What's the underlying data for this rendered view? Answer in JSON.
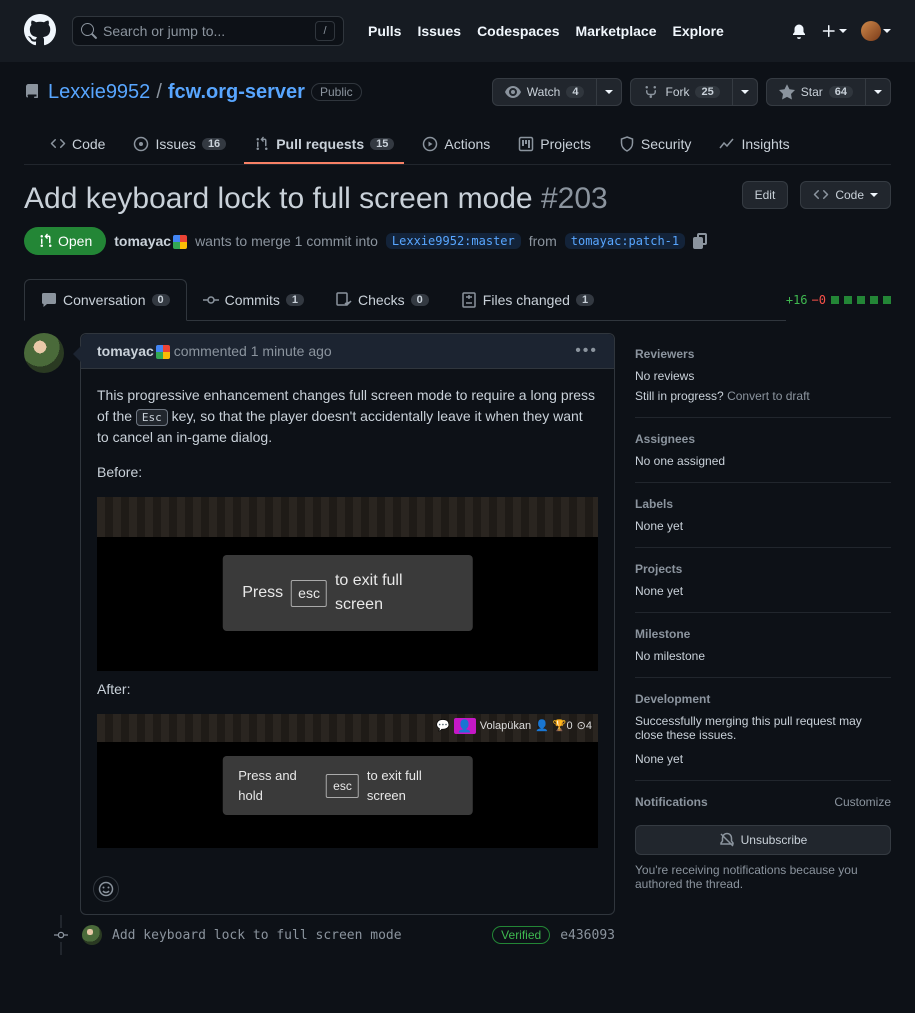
{
  "top": {
    "search_placeholder": "Search or jump to...",
    "nav": {
      "pulls": "Pulls",
      "issues": "Issues",
      "codespaces": "Codespaces",
      "marketplace": "Marketplace",
      "explore": "Explore"
    }
  },
  "repo": {
    "owner": "Lexxie9952",
    "name": "fcw.org-server",
    "visibility": "Public",
    "watch": {
      "label": "Watch",
      "count": "4"
    },
    "fork": {
      "label": "Fork",
      "count": "25"
    },
    "star": {
      "label": "Star",
      "count": "64"
    },
    "tabs": {
      "code": "Code",
      "issues": "Issues",
      "issues_count": "16",
      "pulls": "Pull requests",
      "pulls_count": "15",
      "actions": "Actions",
      "projects": "Projects",
      "security": "Security",
      "insights": "Insights"
    }
  },
  "pr": {
    "title": "Add keyboard lock to full screen mode",
    "number": "#203",
    "edit": "Edit",
    "code_btn": "Code",
    "state": "Open",
    "author": "tomayac",
    "merge_text_1": "wants to merge 1 commit into",
    "base_branch": "Lexxie9952:master",
    "merge_text_2": "from",
    "head_branch": "tomayac:patch-1",
    "subtabs": {
      "conversation": "Conversation",
      "conversation_count": "0",
      "commits": "Commits",
      "commits_count": "1",
      "checks": "Checks",
      "checks_count": "0",
      "files": "Files changed",
      "files_count": "1"
    },
    "diff": {
      "add": "+16",
      "del": "−0"
    }
  },
  "comment": {
    "author": "tomayac",
    "time": "commented 1 minute ago",
    "para1a": "This progressive enhancement changes full screen mode to require a long press of the ",
    "para1_key": "Esc",
    "para1b": " key, so that the player doesn't accidentally leave it when they want to cancel an in-game dialog.",
    "before": "Before:",
    "after": "After:",
    "banner_before_a": "Press ",
    "banner_before_key": "esc",
    "banner_before_b": " to exit full screen",
    "banner_after_a": "Press and hold ",
    "banner_after_key": "esc",
    "banner_after_b": " to exit full screen",
    "civ_name": "Volapükan",
    "civ_a": "0",
    "civ_b": "4"
  },
  "commit": {
    "message": "Add keyboard lock to full screen mode",
    "verified": "Verified",
    "sha": "e436093"
  },
  "sidebar": {
    "reviewers": {
      "h": "Reviewers",
      "v": "No reviews",
      "progress": "Still in progress?",
      "convert": "Convert to draft"
    },
    "assignees": {
      "h": "Assignees",
      "v": "No one assigned"
    },
    "labels": {
      "h": "Labels",
      "v": "None yet"
    },
    "projects": {
      "h": "Projects",
      "v": "None yet"
    },
    "milestone": {
      "h": "Milestone",
      "v": "No milestone"
    },
    "development": {
      "h": "Development",
      "v": "Successfully merging this pull request may close these issues.",
      "v2": "None yet"
    },
    "notifications": {
      "h": "Notifications",
      "customize": "Customize",
      "btn": "Unsubscribe",
      "note": "You're receiving notifications because you authored the thread."
    }
  }
}
